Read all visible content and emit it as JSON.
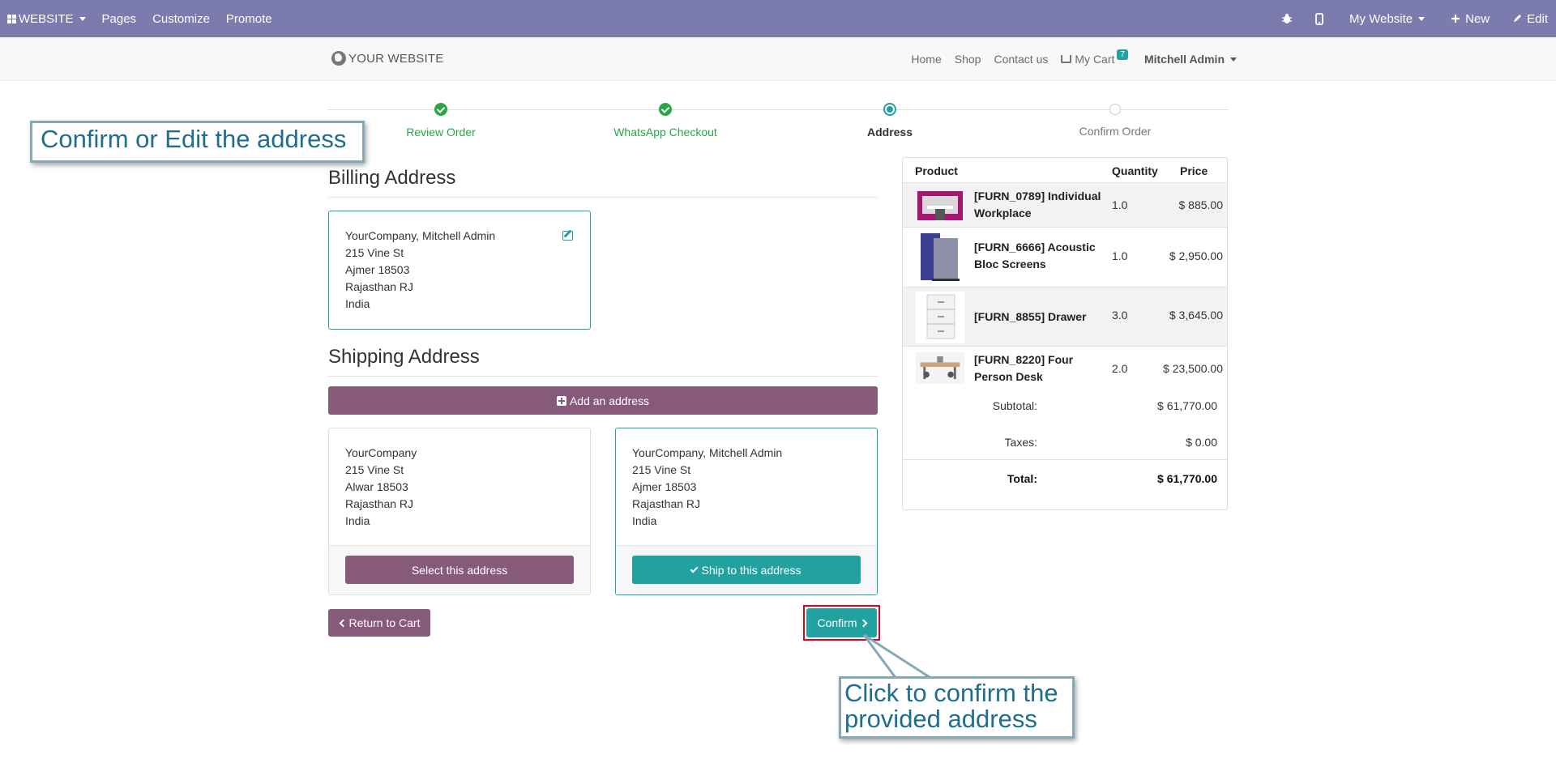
{
  "topbar": {
    "app_label": "WEBSITE",
    "pages": "Pages",
    "customize": "Customize",
    "promote": "Promote",
    "website_selector": "My Website",
    "new": "New",
    "edit": "Edit"
  },
  "header": {
    "logo": "YOUR WEBSITE",
    "nav": [
      "Home",
      "Shop",
      "Contact us"
    ],
    "cart_label": "My Cart",
    "cart_count": "7",
    "user": "Mitchell Admin"
  },
  "steps": [
    {
      "label": "Review Order",
      "state": "done"
    },
    {
      "label": "WhatsApp Checkout",
      "state": "done"
    },
    {
      "label": "Address",
      "state": "current"
    },
    {
      "label": "Confirm Order",
      "state": "todo"
    }
  ],
  "billing": {
    "heading": "Billing Address",
    "lines": [
      "YourCompany, Mitchell Admin",
      "215 Vine St",
      "Ajmer 18503",
      "Rajasthan RJ",
      "India"
    ]
  },
  "shipping": {
    "heading": "Shipping Address",
    "add_label": "Add an address",
    "addresses": [
      {
        "lines": [
          "YourCompany",
          "215 Vine St",
          "Alwar 18503",
          "Rajasthan RJ",
          "India"
        ],
        "button": "Select this address"
      },
      {
        "lines": [
          "YourCompany, Mitchell Admin",
          "215 Vine St",
          "Ajmer 18503",
          "Rajasthan RJ",
          "India"
        ],
        "button": "Ship to this address"
      }
    ]
  },
  "actions": {
    "return": "Return to Cart",
    "confirm": "Confirm"
  },
  "summary": {
    "headers": {
      "product": "Product",
      "quantity": "Quantity",
      "price": "Price"
    },
    "rows": [
      {
        "name": "[FURN_0789] Individual Workplace",
        "qty": "1.0",
        "price": "$ 885.00"
      },
      {
        "name": "[FURN_6666] Acoustic Bloc Screens",
        "qty": "1.0",
        "price": "$ 2,950.00"
      },
      {
        "name": "[FURN_8855] Drawer",
        "qty": "3.0",
        "price": "$ 3,645.00"
      },
      {
        "name": "[FURN_8220] Four Person Desk",
        "qty": "2.0",
        "price": "$ 23,500.00"
      }
    ],
    "subtotal_label": "Subtotal:",
    "subtotal": "$ 61,770.00",
    "taxes_label": "Taxes:",
    "taxes": "$ 0.00",
    "total_label": "Total:",
    "total": "$ 61,770.00"
  },
  "tips": {
    "edit_tip": "Confirm or Edit the address",
    "confirm_tip_line1": "Click to confirm the",
    "confirm_tip_line2": "provided address"
  },
  "colors": {
    "topbar": "#7c7bad",
    "primary": "#875a7b",
    "teal": "#21a1a0",
    "success": "#28a745"
  }
}
